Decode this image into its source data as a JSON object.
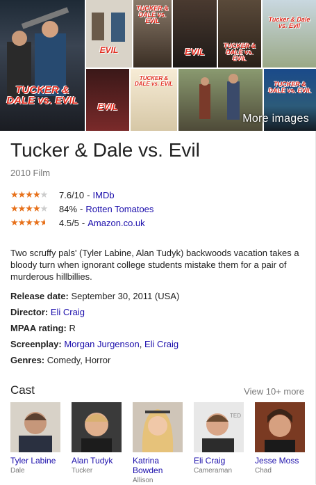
{
  "images": {
    "more_label": "More images",
    "tiles": [
      {
        "caption": "TUCKER & DALE vs. EVIL",
        "bg": "#3a4452"
      },
      {
        "caption": "EVIL",
        "bg": "#d9d3c8"
      },
      {
        "caption": "TUCKER & DALE vs. EVIL",
        "bg": "#5a4a3a"
      },
      {
        "caption": "EVIL",
        "bg": "#2a2624"
      },
      {
        "caption": "TUCKER & DALE vs. EVIL",
        "bg": "#3e3226"
      },
      {
        "caption": "Tucker & Dale vs. Evil",
        "bg": "#b7c4b3"
      },
      {
        "caption": "EVIL",
        "bg": "#5b2525"
      },
      {
        "caption": "TUCKER & DALE vs. EVIL",
        "bg": "#f1e5cc"
      },
      {
        "caption": "",
        "bg": "#6f6a55"
      },
      {
        "caption": "TUCKER & DALE vs. EVIL",
        "bg": "#2c5b7a"
      }
    ]
  },
  "title": "Tucker & Dale vs. Evil",
  "subtitle": "2010 Film",
  "ratings": [
    {
      "score": "7.6/10",
      "source": "IMDb",
      "stars_filled": 4,
      "stars_half": 0
    },
    {
      "score": "84%",
      "source": "Rotten Tomatoes",
      "stars_filled": 4,
      "stars_half": 0
    },
    {
      "score": "4.5/5",
      "source": "Amazon.co.uk",
      "stars_filled": 4,
      "stars_half": 1
    }
  ],
  "description": "Two scruffy pals' (Tyler Labine, Alan Tudyk) backwoods vacation takes a bloody turn when ignorant college students mistake them for a pair of murderous hillbillies.",
  "facts": {
    "release_label": "Release date:",
    "release_value": "September 30, 2011 (USA)",
    "director_label": "Director:",
    "director_value": "Eli Craig",
    "mpaa_label": "MPAA rating:",
    "mpaa_value": "R",
    "screenplay_label": "Screenplay:",
    "screenplay_value_1": "Morgan Jurgenson",
    "screenplay_sep": ",",
    "screenplay_value_2": "Eli Craig",
    "genres_label": "Genres:",
    "genres_value": "Comedy, Horror"
  },
  "cast": {
    "heading": "Cast",
    "view_more": "View 10+ more",
    "members": [
      {
        "name": "Tyler Labine",
        "role": "Dale",
        "color": "#55504a"
      },
      {
        "name": "Alan Tudyk",
        "role": "Tucker",
        "color": "#7e6a52"
      },
      {
        "name": "Katrina Bowden",
        "role": "Allison",
        "color": "#a08a70"
      },
      {
        "name": "Eli Craig",
        "role": "Cameraman",
        "color": "#7a6655"
      },
      {
        "name": "Jesse Moss",
        "role": "Chad",
        "color": "#5a3b2a"
      }
    ]
  },
  "colors": {
    "star": "#e7711b",
    "link": "#1a0dab",
    "muted": "#777777"
  }
}
